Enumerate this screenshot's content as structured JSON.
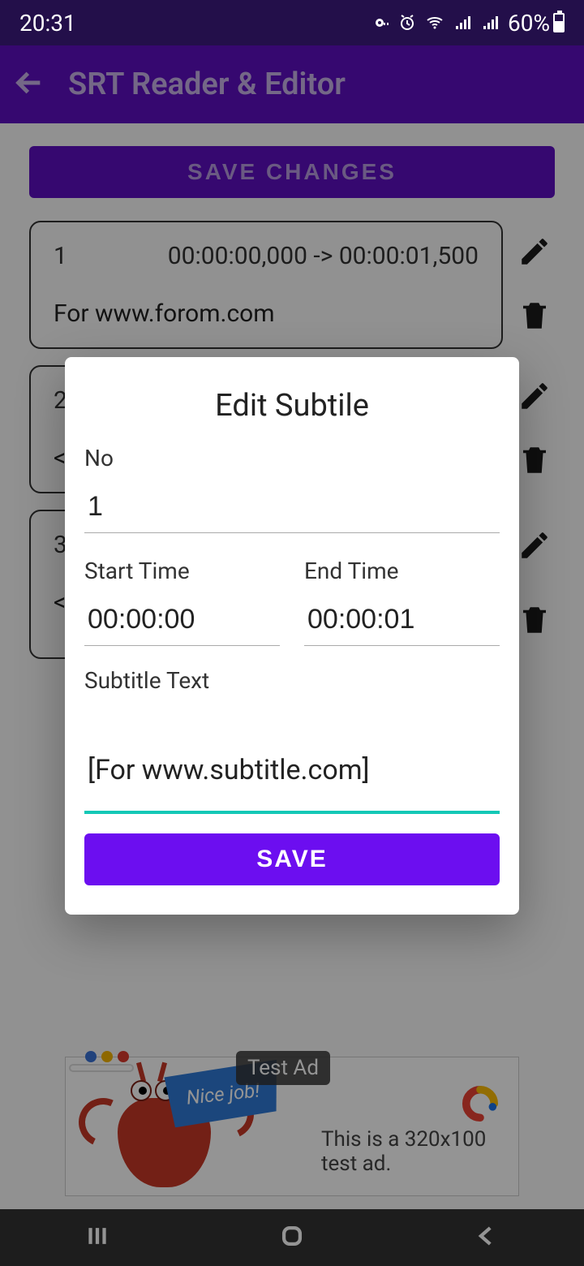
{
  "status": {
    "time": "20:31",
    "battery": "60%"
  },
  "appbar": {
    "title": "SRT Reader & Editor"
  },
  "buttons": {
    "save_changes": "SAVE CHANGES",
    "dialog_save": "SAVE"
  },
  "entries": [
    {
      "index": "1",
      "time": "00:00:00,000 -> 00:00:01,500",
      "text": "For www.forom.com"
    },
    {
      "index": "2",
      "time": "",
      "text": "<"
    },
    {
      "index": "3",
      "time": "",
      "text": "<"
    }
  ],
  "dialog": {
    "title": "Edit Subtile",
    "labels": {
      "no": "No",
      "start": "Start Time",
      "end": "End Time",
      "subtitle": "Subtitle Text"
    },
    "values": {
      "no": "1",
      "start": "00:00:00",
      "end": "00:00:01",
      "text": "[For www.subtitle.com]"
    }
  },
  "ad": {
    "badge": "Test Ad",
    "flag": "Nice job!",
    "text": "This is a 320x100 test ad."
  }
}
